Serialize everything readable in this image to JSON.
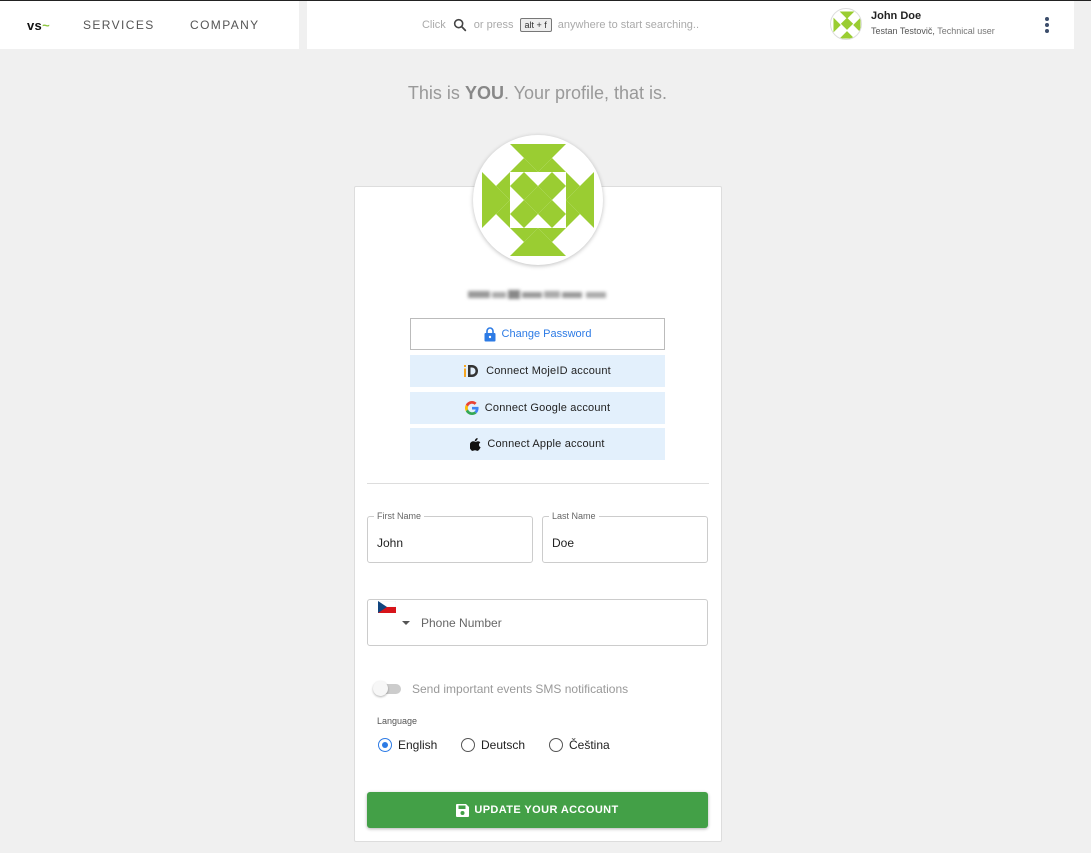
{
  "nav": {
    "logo_text": "vs",
    "logo_tilde": "~",
    "services": "SERVICES",
    "company": "COMPANY"
  },
  "search": {
    "click": "Click",
    "or_press": "or press",
    "shortcut": "alt + f",
    "rest": "anywhere to start searching.."
  },
  "user": {
    "name": "John Doe",
    "sub_name": "Testan Testovič,",
    "sub_role": "Technical user"
  },
  "heading": {
    "prefix": "This is ",
    "bold": "YOU",
    "suffix": ". Your profile, that is."
  },
  "profile": {
    "change_password": "Change Password",
    "connect_mojeid": "Connect MojeID account",
    "connect_google": "Connect Google account",
    "connect_apple": "Connect Apple account"
  },
  "form": {
    "first_name_label": "First Name",
    "first_name_value": "John",
    "last_name_label": "Last Name",
    "last_name_value": "Doe",
    "phone_placeholder": "Phone Number",
    "sms_label": "Send important events SMS notifications",
    "language_label": "Language",
    "languages": [
      "English",
      "Deutsch",
      "Čeština"
    ],
    "selected_language": "English",
    "update_button": "UPDATE YOUR ACCOUNT"
  },
  "colors": {
    "accent_green": "#8dc63f",
    "avatar_green": "#9acd32",
    "button_green": "#43a047",
    "link_blue": "#2d7be5",
    "connect_bg": "#e3f0fc"
  }
}
